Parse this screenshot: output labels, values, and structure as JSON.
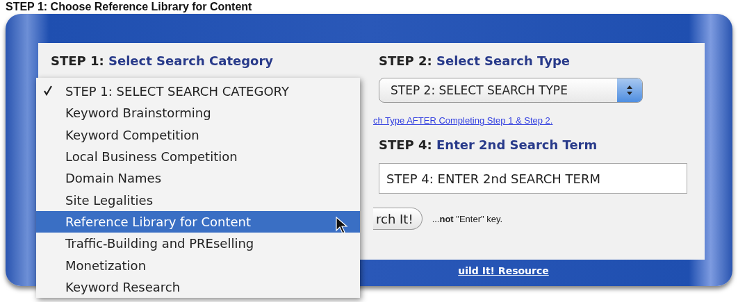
{
  "page_title": "STEP 1: Choose Reference Library for Content",
  "step1_heading": {
    "step": "STEP 1:",
    "text": "Select Search Category"
  },
  "step2_heading": {
    "step": "STEP 2:",
    "text": "Select Search Type"
  },
  "step2_select": {
    "value": "STEP 2: SELECT SEARCH TYPE"
  },
  "info_link": "ch Type AFTER Completing Step 1 & Step 2.",
  "step4_heading": {
    "step": "STEP 4:",
    "text": "Enter 2nd Search Term"
  },
  "step4_field": {
    "value": "STEP 4: ENTER 2nd SEARCH TERM"
  },
  "search_button": "rch It!",
  "key_note": "...**not** \"Enter\" key.",
  "footer_link": "uild It! Resource",
  "category_menu": [
    {
      "label": "STEP 1: SELECT SEARCH CATEGORY",
      "checked": true,
      "selected": false
    },
    {
      "label": "Keyword Brainstorming",
      "checked": false,
      "selected": false
    },
    {
      "label": "Keyword Competition",
      "checked": false,
      "selected": false
    },
    {
      "label": "Local Business Competition",
      "checked": false,
      "selected": false
    },
    {
      "label": "Domain Names",
      "checked": false,
      "selected": false
    },
    {
      "label": "Site Legalities",
      "checked": false,
      "selected": false
    },
    {
      "label": "Reference Library for Content",
      "checked": false,
      "selected": true
    },
    {
      "label": "Traffic-Building and PREselling",
      "checked": false,
      "selected": false
    },
    {
      "label": "Monetization",
      "checked": false,
      "selected": false
    },
    {
      "label": "Keyword Research",
      "checked": false,
      "selected": false
    }
  ]
}
